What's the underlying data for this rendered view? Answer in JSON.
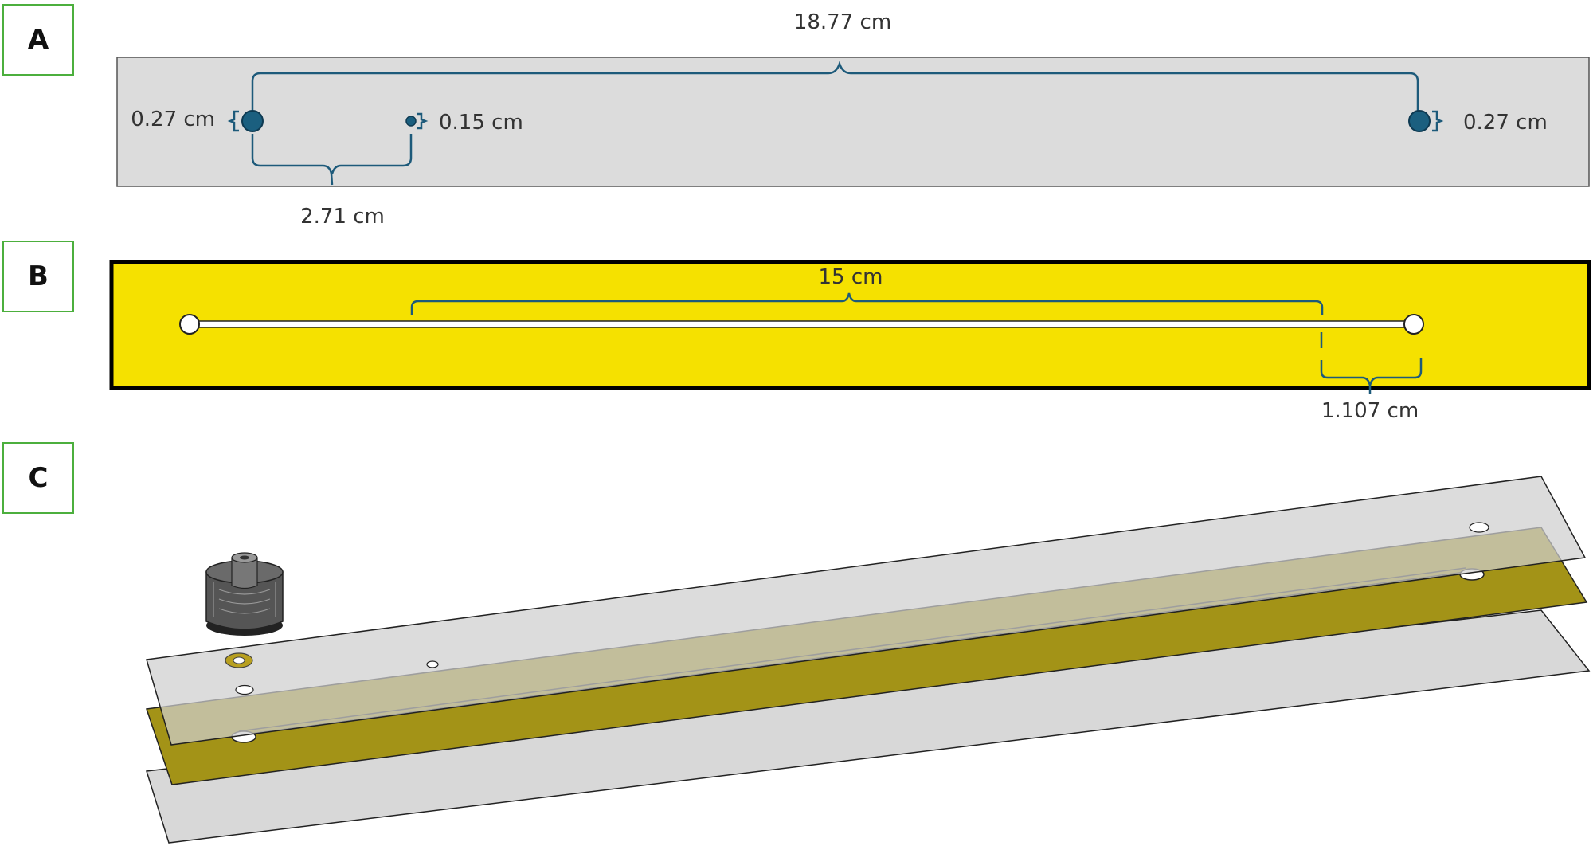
{
  "panels": {
    "a": {
      "label": "A",
      "dims": {
        "overall": "18.77 cm",
        "left_hole": "0.27 cm",
        "small_hole": "0.15 cm",
        "right_hole": "0.27 cm",
        "hole_spacing": "2.71 cm"
      }
    },
    "b": {
      "label": "B",
      "dims": {
        "channel_length": "15 cm",
        "end_offset": "1.107 cm"
      }
    },
    "c": {
      "label": "C"
    }
  },
  "colors": {
    "bracket": "#1d5a7a",
    "hole_fill": "#1b5f7f",
    "plate_gray": "#dcdcdc",
    "channel_layer": "#f5e100",
    "channel_layer_3d": "#a39317",
    "label_border": "#4caf3d"
  }
}
